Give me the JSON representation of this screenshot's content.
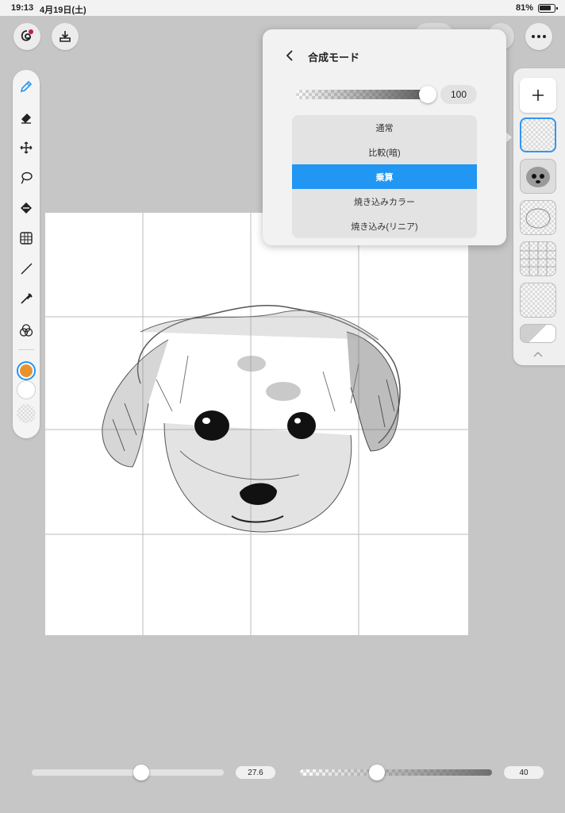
{
  "status_bar": {
    "time": "19:13",
    "date": "4月19日(土)",
    "battery": "81%"
  },
  "canvas_grid": {
    "rows": 4,
    "cols": 4
  },
  "blend_popover": {
    "title": "合成モード",
    "opacity_value": "100",
    "opacity_level": 1.0,
    "modes": [
      "通常",
      "比較(暗)",
      "乗算",
      "焼き込みカラー",
      "焼き込み(リニア)"
    ],
    "selected_mode": "乗算"
  },
  "colors": {
    "accent": "#2196f3",
    "primary_color": "#e8922e",
    "secondary_color": "#ffffff"
  },
  "bottom_sliders": {
    "brush_size_value": "27.6",
    "brush_size_level": 0.57,
    "brush_opacity_value": "40",
    "brush_opacity_level": 0.4
  },
  "icons": {
    "left_top": [
      "brush-settings-icon",
      "import-icon"
    ],
    "toolbar": [
      "pen-icon",
      "eraser-icon",
      "move-icon",
      "lasso-icon",
      "fill-icon",
      "grid-icon",
      "line-icon",
      "eyedropper-icon",
      "blend-tool-icon"
    ],
    "layers": [
      "add-layer-icon",
      "chevron-up-icon"
    ],
    "top_right": [
      "more-icon"
    ]
  }
}
